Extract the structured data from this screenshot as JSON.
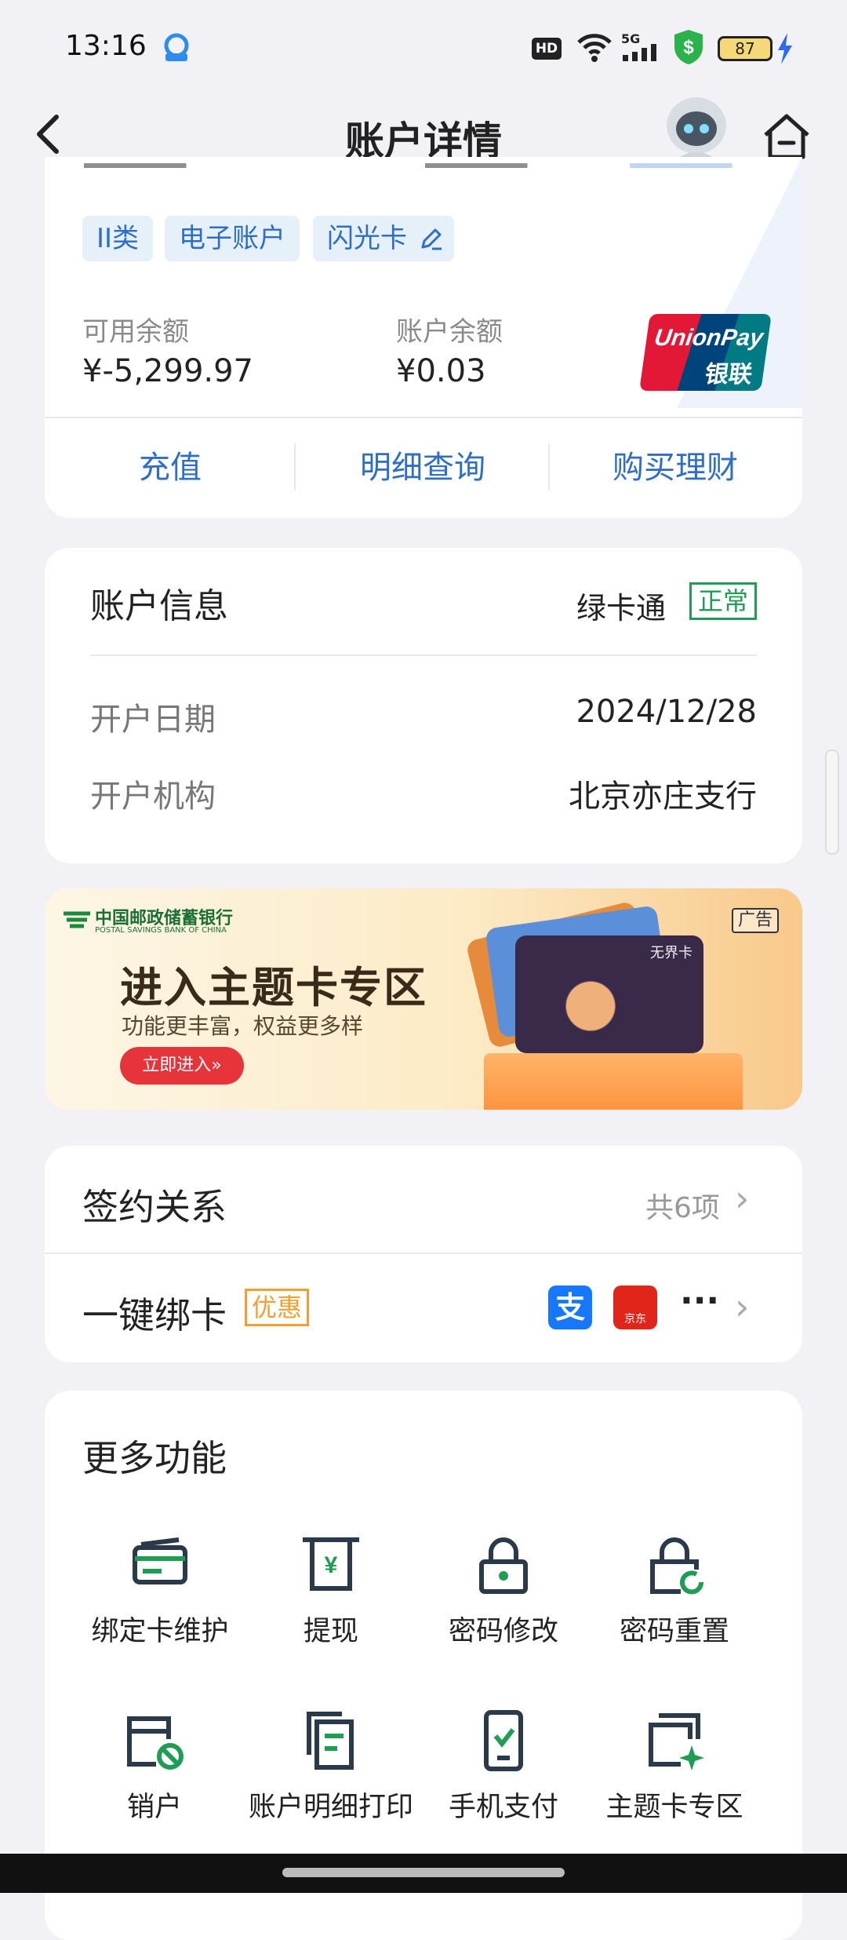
{
  "status_bar": {
    "time": "13:16",
    "battery": "87",
    "network": "5G",
    "hd": "HD"
  },
  "header": {
    "title": "账户详情"
  },
  "account_card": {
    "tags": [
      "II类",
      "电子账户",
      "闪光卡"
    ],
    "available_label": "可用余额",
    "available_value": "¥-5,299.97",
    "balance_label": "账户余额",
    "balance_value": "¥0.03",
    "unionpay_text": "UnionPay",
    "unionpay_cn": "银联",
    "actions": [
      "充值",
      "明细查询",
      "购买理财"
    ]
  },
  "account_info": {
    "title": "账户信息",
    "card_type": "绿卡通",
    "status": "正常",
    "open_date_label": "开户日期",
    "open_date_value": "2024/12/28",
    "branch_label": "开户机构",
    "branch_value": "北京亦庄支行"
  },
  "banner": {
    "bank_name_cn": "中国邮政储蓄银行",
    "bank_name_en": "POSTAL SAVINGS BANK OF CHINA",
    "ad_tag": "广告",
    "headline": "进入主题卡专区",
    "subline": "功能更丰富，权益更多样",
    "cta": "立即进入»",
    "card_brand": "无界卡"
  },
  "contracts": {
    "title": "签约关系",
    "count": "共6项",
    "bind_title": "一键绑卡",
    "bind_badge": "优惠",
    "more": "···",
    "jd_label": "京东"
  },
  "more_functions": {
    "title": "更多功能",
    "items": [
      {
        "label": "绑定卡维护",
        "icon": "card-icon"
      },
      {
        "label": "提现",
        "icon": "withdraw-icon"
      },
      {
        "label": "密码修改",
        "icon": "lock-icon"
      },
      {
        "label": "密码重置",
        "icon": "lock-reset-icon"
      },
      {
        "label": "销户",
        "icon": "close-account-icon"
      },
      {
        "label": "账户明细打印",
        "icon": "print-detail-icon"
      },
      {
        "label": "手机支付",
        "icon": "phone-pay-icon"
      },
      {
        "label": "主题卡专区",
        "icon": "theme-card-icon"
      }
    ]
  },
  "colors": {
    "accent": "#2f6ec6",
    "green": "#1f9d55",
    "bg": "#f1f1f6"
  }
}
